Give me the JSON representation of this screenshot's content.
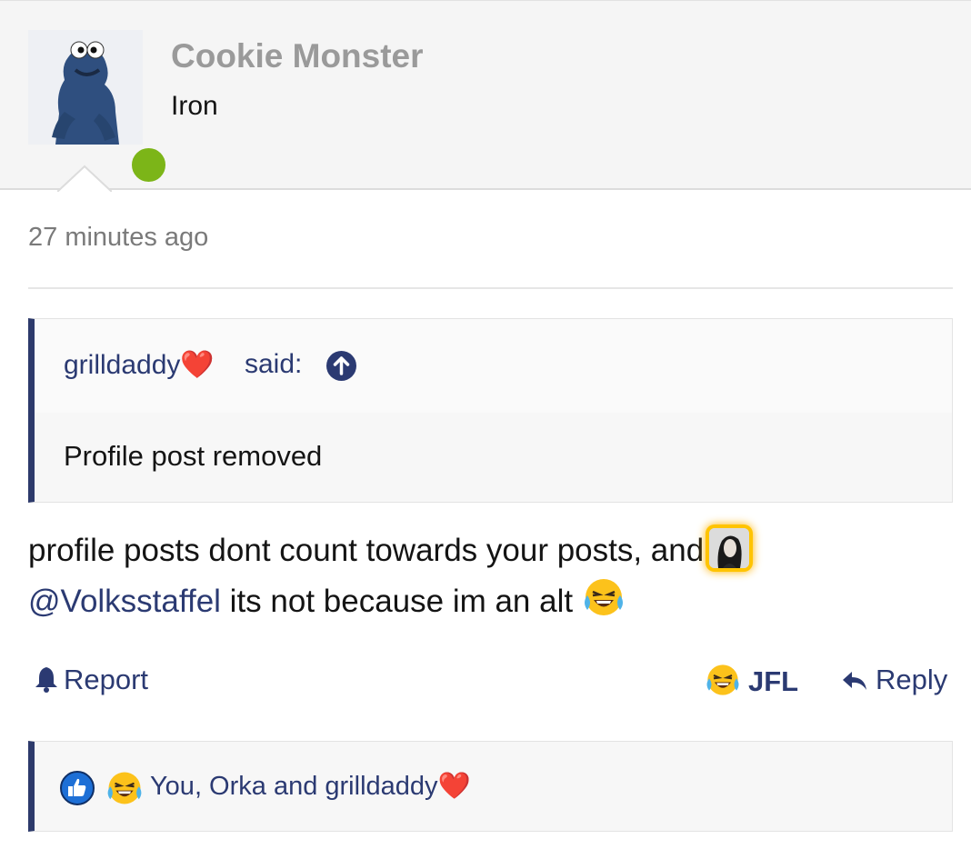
{
  "profile": {
    "username": "Cookie Monster",
    "user_title": "Iron",
    "online": true,
    "online_color": "#7cb518"
  },
  "post": {
    "timestamp": "27 minutes ago",
    "quote": {
      "author": "grilldaddy",
      "author_suffix": "❤️",
      "said_label": "said:",
      "body": "Profile post removed"
    },
    "message": {
      "text_before": "profile posts dont count towards your posts, and",
      "mention": "@Volksstaffel",
      "text_after": " its not because im an alt"
    },
    "actions": {
      "report_label": "Report",
      "reaction_label": "JFL",
      "reply_label": "Reply"
    },
    "reactions_summary": "You, Orka and grilldaddy❤️"
  },
  "colors": {
    "accent": "#2b3a72",
    "header_bg": "#f5f5f5",
    "quote_border": "#2d3a6b"
  },
  "icons": {
    "online": "online-status-icon",
    "jump": "arrow-up-circle-icon",
    "report": "bell-icon",
    "reply": "reply-arrow-icon",
    "like": "thumbs-up-icon",
    "laugh": "laughing-tears-emoji"
  }
}
